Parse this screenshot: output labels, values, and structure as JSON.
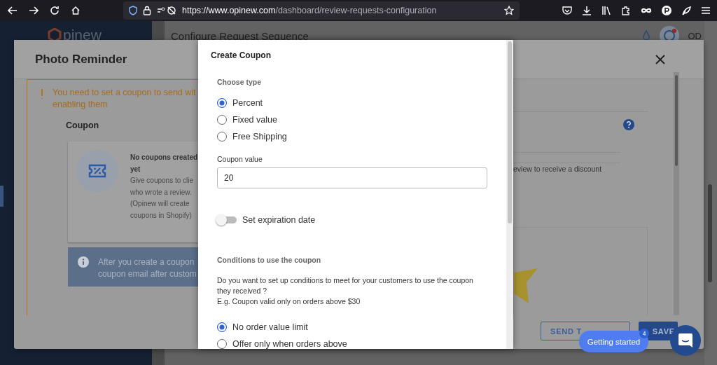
{
  "browser": {
    "url_host": "https://www.opinew.com",
    "url_path": "/dashboard/review-requests-configuration"
  },
  "app": {
    "logo": "pinew",
    "page_title": "Configure Request Sequence",
    "avatar": "OD"
  },
  "photo_reminder": {
    "title": "Photo Reminder",
    "warning_lines": [
      "You need to set a coupon to send wit",
      "enabling them"
    ],
    "section_title": "Coupon",
    "empty_title_lines": [
      "No coupons created",
      "yet"
    ],
    "empty_text_lines": [
      "Give coupons to clie",
      "who wrote a review.",
      "(Opinew will create",
      "coupons in Shopify)"
    ],
    "info_lines": [
      "After you create a coupon",
      "coupon email after custom"
    ],
    "side_text": "eview to receive a discount",
    "buttons": [
      {
        "label": "SEND T",
        "kind": "outline"
      },
      {
        "label": "SAVE",
        "kind": "primary"
      }
    ]
  },
  "create_coupon": {
    "title": "Create Coupon",
    "type_label": "Choose type",
    "type_options": [
      {
        "label": "Percent",
        "selected": true
      },
      {
        "label": "Fixed value",
        "selected": false
      },
      {
        "label": "Free Shipping",
        "selected": false
      }
    ],
    "value_label": "Coupon value",
    "value": "20",
    "expiration": {
      "label": "Set expiration date",
      "on": false
    },
    "conditions_title": "Conditions to use the coupon",
    "conditions_lines": [
      "Do you want to set up conditions to meet for your customers to use the coupon",
      "they received ?",
      "E.g. Coupon valid only on orders above $30"
    ],
    "condition_options": [
      {
        "label": "No order value limit",
        "selected": true
      },
      {
        "label": "Offer only when orders above",
        "selected": false
      }
    ]
  },
  "widget": {
    "label": "Getting started",
    "badge": "4"
  }
}
